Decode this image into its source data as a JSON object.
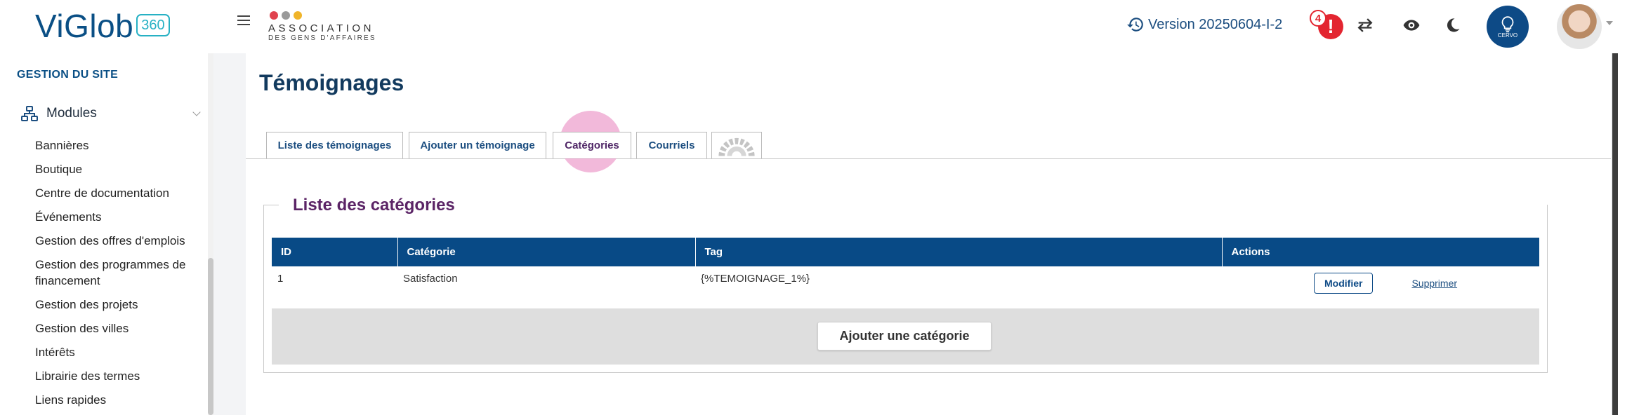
{
  "brand": {
    "logo_text": "ViGlob",
    "logo_badge": "360",
    "accent": "#27b1c4",
    "primary": "#0a4f85"
  },
  "association": {
    "title": "ASSOCIATION",
    "subtitle": "DES GENS D'AFFAIRES",
    "dot_colors": [
      "#e0434f",
      "#9a9a9a",
      "#f0b429"
    ]
  },
  "header": {
    "version": "Version 20250604-I-2",
    "alert_count": "4",
    "alert_symbol": "!",
    "cerve_label": "CERVO",
    "icons": [
      "history-icon",
      "alert-icon",
      "swap-icon",
      "eye-icon",
      "moon-icon",
      "lightbulb-icon",
      "avatar",
      "chevron-down-icon"
    ]
  },
  "sidebar": {
    "heading": "GESTION DU SITE",
    "modules_label": "Modules",
    "items": [
      "Bannières",
      "Boutique",
      "Centre de documentation",
      "Événements",
      "Gestion des offres d'emplois",
      "Gestion des programmes de financement",
      "Gestion des projets",
      "Gestion des villes",
      "Intérêts",
      "Librairie des termes",
      "Liens rapides"
    ]
  },
  "main": {
    "title": "Témoignages",
    "tabs": [
      {
        "label": "Liste des témoignages"
      },
      {
        "label": "Ajouter un témoignage"
      },
      {
        "label": "Catégories",
        "active": true
      },
      {
        "label": "Courriels"
      },
      {
        "label": "",
        "icon": "gear-icon"
      }
    ],
    "section_title": "Liste des catégories",
    "table": {
      "headers": [
        "ID",
        "Catégorie",
        "Tag",
        "Actions"
      ],
      "rows": [
        {
          "id": "1",
          "categorie": "Satisfaction",
          "tag": "{%TEMOIGNAGE_1%}",
          "edit": "Modifier",
          "delete": "Supprimer"
        }
      ]
    },
    "add_button": "Ajouter une catégorie"
  }
}
